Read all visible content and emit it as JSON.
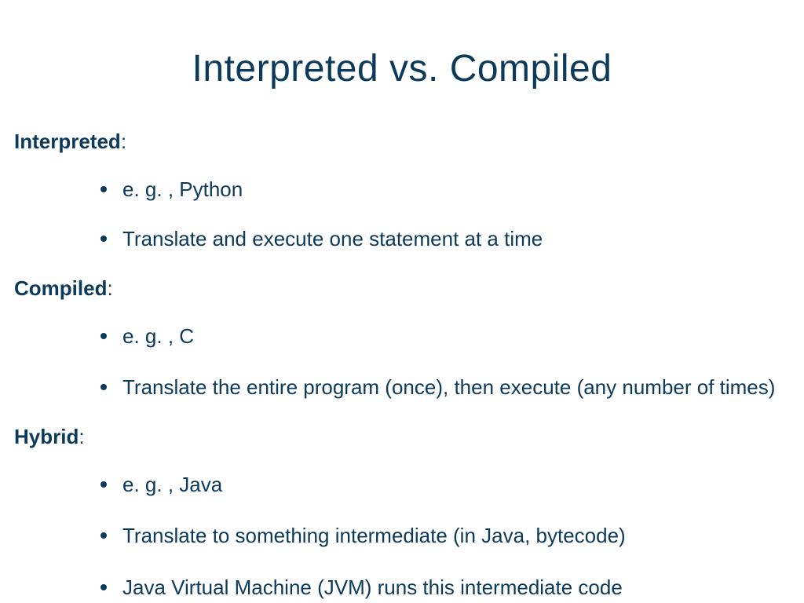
{
  "title": "Interpreted vs. Compiled",
  "sections": {
    "interpreted": {
      "label": "Interpreted",
      "colon": ":",
      "bullets": [
        "e. g. , Python",
        "Translate and execute one statement at a time"
      ]
    },
    "compiled": {
      "label": "Compiled",
      "colon": ":",
      "bullets": [
        "e. g. , C",
        "Translate the entire program (once), then execute (any number of times)"
      ]
    },
    "hybrid": {
      "label": "Hybrid",
      "colon": ":",
      "bullets": [
        "e. g. , Java",
        "Translate to something intermediate (in Java, bytecode)",
        "Java Virtual Machine (JVM) runs this intermediate code"
      ]
    }
  }
}
